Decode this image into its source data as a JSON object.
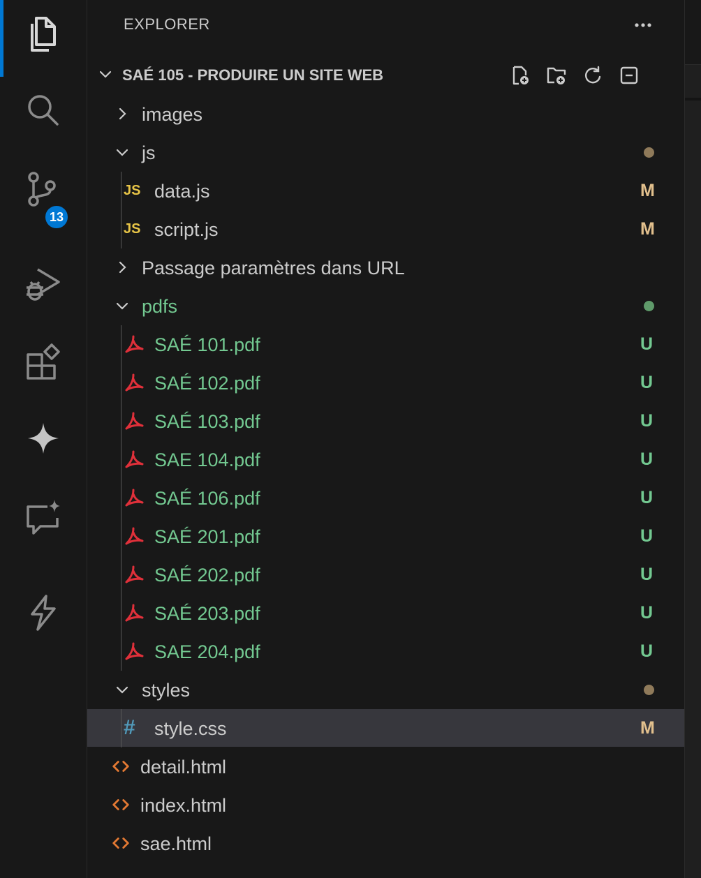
{
  "activity_bar": {
    "items": [
      {
        "name": "explorer",
        "icon": "files-icon",
        "active": true
      },
      {
        "name": "search",
        "icon": "search-icon"
      },
      {
        "name": "source-control",
        "icon": "source-control-icon",
        "badge": "13"
      },
      {
        "name": "run-and-debug",
        "icon": "run-debug-icon"
      },
      {
        "name": "extensions",
        "icon": "extensions-icon"
      },
      {
        "name": "copilot",
        "icon": "sparkle-icon"
      },
      {
        "name": "chat",
        "icon": "chat-sparkle-icon"
      },
      {
        "name": "lightning",
        "icon": "lightning-icon"
      }
    ],
    "accent_color": "#0078d4"
  },
  "explorer": {
    "title": "EXPLORER",
    "more_label": "···",
    "workspace": "SAÉ 105 - PRODUIRE UN SITE WEB",
    "header_actions": [
      "new-file-icon",
      "new-folder-icon",
      "refresh-icon",
      "collapse-all-icon"
    ],
    "tree": [
      {
        "label": "images",
        "type": "folder",
        "expanded": false,
        "depth": 0,
        "color": "#cccccc"
      },
      {
        "label": "js",
        "type": "folder",
        "expanded": true,
        "depth": 0,
        "dot": "#8f7a5a",
        "color": "#cccccc"
      },
      {
        "label": "data.js",
        "type": "js",
        "icon_text": "JS",
        "depth": 1,
        "status": "M",
        "color": "#cccccc"
      },
      {
        "label": "script.js",
        "type": "js",
        "icon_text": "JS",
        "depth": 1,
        "status": "M",
        "color": "#cccccc"
      },
      {
        "label": "Passage paramètres dans URL",
        "type": "folder",
        "expanded": false,
        "depth": 0,
        "color": "#cccccc"
      },
      {
        "label": "pdfs",
        "type": "folder",
        "expanded": true,
        "depth": 0,
        "dot": "#5f9a6a",
        "color": "#73c991"
      },
      {
        "label": "SAÉ 101.pdf",
        "type": "pdf",
        "depth": 1,
        "status": "U",
        "color": "#73c991"
      },
      {
        "label": "SAÉ 102.pdf",
        "type": "pdf",
        "depth": 1,
        "status": "U",
        "color": "#73c991"
      },
      {
        "label": "SAÉ 103.pdf",
        "type": "pdf",
        "depth": 1,
        "status": "U",
        "color": "#73c991"
      },
      {
        "label": "SAE 104.pdf",
        "type": "pdf",
        "depth": 1,
        "status": "U",
        "color": "#73c991"
      },
      {
        "label": "SAÉ 106.pdf",
        "type": "pdf",
        "depth": 1,
        "status": "U",
        "color": "#73c991"
      },
      {
        "label": "SAÉ 201.pdf",
        "type": "pdf",
        "depth": 1,
        "status": "U",
        "color": "#73c991"
      },
      {
        "label": "SAÉ 202.pdf",
        "type": "pdf",
        "depth": 1,
        "status": "U",
        "color": "#73c991"
      },
      {
        "label": "SAÉ 203.pdf",
        "type": "pdf",
        "depth": 1,
        "status": "U",
        "color": "#73c991"
      },
      {
        "label": "SAE 204.pdf",
        "type": "pdf",
        "depth": 1,
        "status": "U",
        "color": "#73c991"
      },
      {
        "label": "styles",
        "type": "folder",
        "expanded": true,
        "depth": 0,
        "dot": "#8f7a5a",
        "color": "#cccccc"
      },
      {
        "label": "style.css",
        "type": "css",
        "icon_text": "#",
        "depth": 1,
        "status": "M",
        "color": "#cccccc",
        "selected": true
      },
      {
        "label": "detail.html",
        "type": "html",
        "depth": 0,
        "color": "#cccccc"
      },
      {
        "label": "index.html",
        "type": "html",
        "depth": 0,
        "color": "#cccccc"
      },
      {
        "label": "sae.html",
        "type": "html",
        "depth": 0,
        "color": "#cccccc"
      }
    ],
    "status_colors": {
      "M": "#e2c08d",
      "U": "#73c991"
    }
  }
}
